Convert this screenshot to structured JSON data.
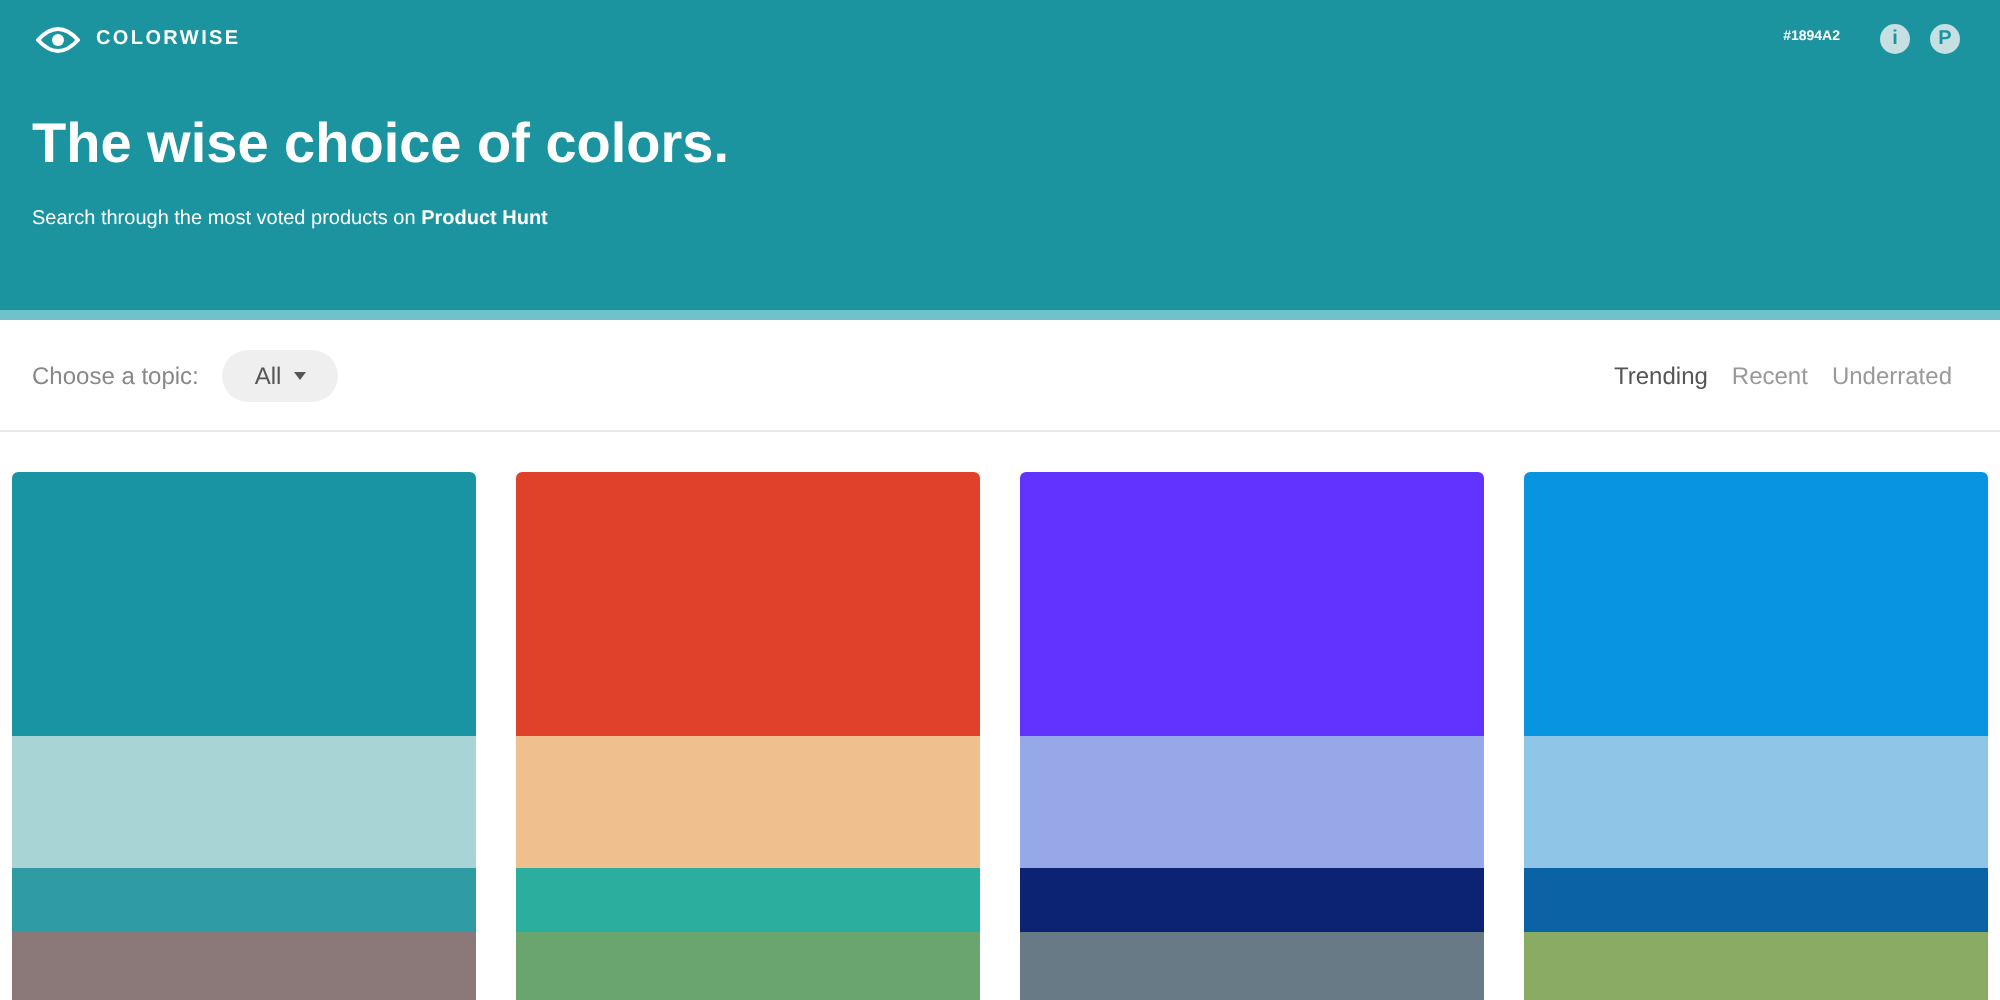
{
  "header": {
    "brand": "COLORWISE",
    "hex": "#1894A2",
    "info_button": "i",
    "producthunt_button": "P",
    "title": "The wise choice of colors.",
    "subtitle": "Search through the most voted products on **Product Hunt**"
  },
  "toolbar": {
    "topic_label": "Choose a topic:",
    "topic_value": "All",
    "sort_tabs": [
      {
        "label": "Trending",
        "selected": true
      },
      {
        "label": "Recent",
        "selected": false
      },
      {
        "label": "Underrated",
        "selected": false
      }
    ]
  },
  "palettes": [
    {
      "swatches": [
        {
          "color": "#1894a2"
        },
        {
          "color": "#a8d4d6"
        },
        {
          "color": "#2f9ba3"
        },
        {
          "color": "#8b7878"
        }
      ]
    },
    {
      "swatches": [
        {
          "color": "#e0412b"
        },
        {
          "color": "#efc08e"
        },
        {
          "color": "#2bae9d"
        },
        {
          "color": "#6aa570"
        }
      ]
    },
    {
      "swatches": [
        {
          "color": "#6232ff"
        },
        {
          "color": "#97a8e9"
        },
        {
          "color": "#0b2372"
        },
        {
          "color": "#677a86"
        }
      ]
    },
    {
      "swatches": [
        {
          "color": "#0794e0"
        },
        {
          "color": "#8fc6e8"
        },
        {
          "color": "#0b62a5"
        },
        {
          "color": "#8aab63"
        }
      ]
    }
  ]
}
